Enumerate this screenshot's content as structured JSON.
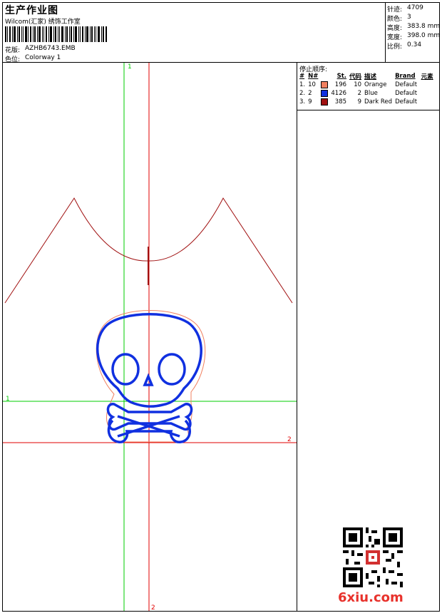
{
  "header": {
    "title": "生产作业图",
    "subtitle": "Wilcom(汇家) 绣饰工作室",
    "design_label": "花版:",
    "design_value": "AZHB6743.EMB",
    "colorway_label": "色位:",
    "colorway_value": "Colorway 1"
  },
  "stats": [
    {
      "label": "针迹:",
      "value": "4709"
    },
    {
      "label": "颜色:",
      "value": "3"
    },
    {
      "label": "高度:",
      "value": "383.8 mm"
    },
    {
      "label": "宽度:",
      "value": "398.0 mm"
    },
    {
      "label": "比例:",
      "value": "0.34"
    }
  ],
  "stop_sequence": {
    "title": "停止顺序:",
    "headers": [
      "#",
      "N#",
      "",
      "St.",
      "代码",
      "描述",
      "Brand",
      "元素"
    ],
    "rows": [
      {
        "idx": "1.",
        "n": "10",
        "color": "#f08060",
        "st": "196",
        "code": "10",
        "desc": "Orange",
        "brand": "Default"
      },
      {
        "idx": "2.",
        "n": "2",
        "color": "#1030e0",
        "st": "4126",
        "code": "2",
        "desc": "Blue",
        "brand": "Default"
      },
      {
        "idx": "3.",
        "n": "9",
        "color": "#a01010",
        "st": "385",
        "code": "9",
        "desc": "Dark Red",
        "brand": "Default"
      }
    ]
  },
  "guides": {
    "v1_label": "1",
    "h1_label": "1",
    "h2_label": "2",
    "v2_label": "2"
  },
  "colors": {
    "green_guide": "#00cc00",
    "red_guide": "#e00000",
    "outline_dark_red": "#a01010",
    "skull_blue": "#1030e0",
    "skull_orange": "#f08060"
  },
  "watermark": "6xiu.com"
}
